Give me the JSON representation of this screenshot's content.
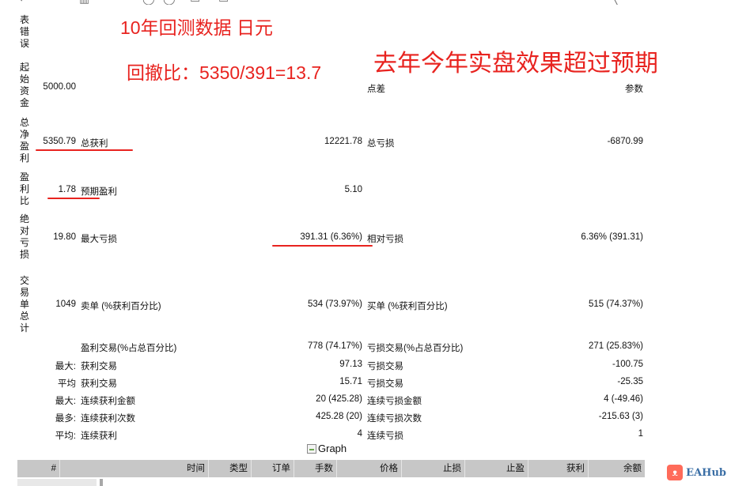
{
  "vertical_labels": {
    "report_error": "表错误",
    "initial_capital": "起始资金",
    "total_net_profit": "总净盈利",
    "profit_ratio": "盈利比",
    "absolute_loss": "绝对亏损",
    "total_trades": "交易单总计"
  },
  "annotations": {
    "title": "10年回测数据 日元",
    "drawdown_ratio": "回撤比：5350/391=13.7",
    "live_note": "去年今年实盘效果超过预期"
  },
  "report": {
    "initial_capital": "5000.00",
    "spread_label": "点差",
    "params_label": "参数",
    "net_profit": "5350.79",
    "gross_profit_label": "总获利",
    "gross_profit": "12221.78",
    "gross_loss_label": "总亏损",
    "gross_loss": "-6870.99",
    "profit_ratio": "1.78",
    "expected_payoff_label": "预期盈利",
    "expected_payoff": "5.10",
    "absolute_drawdown": "19.80",
    "max_drawdown_label": "最大亏损",
    "max_drawdown": "391.31 (6.36%)",
    "relative_drawdown_label": "相对亏损",
    "relative_drawdown": "6.36% (391.31)",
    "total_trades": "1049",
    "short_label": "卖单 (%获利百分比)",
    "short_value": "534 (73.97%)",
    "long_label": "买单 (%获利百分比)",
    "long_value": "515 (74.37%)",
    "profit_trades_label": "盈利交易(%占总百分比)",
    "profit_trades": "778 (74.17%)",
    "loss_trades_label": "亏损交易(%占总百分比)",
    "loss_trades": "271 (25.83%)",
    "largest_prefix": "最大:",
    "largest_profit_label": "获利交易",
    "largest_profit": "97.13",
    "largest_loss_label": "亏损交易",
    "largest_loss": "-100.75",
    "average_prefix": "平均",
    "average_profit_label": "获利交易",
    "average_profit": "15.71",
    "average_loss_label": "亏损交易",
    "average_loss": "-25.35",
    "max_prefix": "最大:",
    "max_consec_wins_label": "连续获利金额",
    "max_consec_wins": "20 (425.28)",
    "max_consec_losses_label": "连续亏损金额",
    "max_consec_losses": "4 (-49.46)",
    "most_prefix": "最多:",
    "max_consec_profit_label": "连续获利次数",
    "max_consec_profit": "425.28 (20)",
    "max_consec_loss_label": "连续亏损次数",
    "max_consec_loss": "-215.63 (3)",
    "avg_prefix": "平均:",
    "avg_consec_wins_label": "连续获利",
    "avg_consec_wins": "4",
    "avg_consec_losses_label": "连续亏损",
    "avg_consec_losses": "1"
  },
  "graph_alt": "Graph",
  "table_headers": [
    "#",
    "时间",
    "类型",
    "订单",
    "手数",
    "价格",
    "止损",
    "止盈",
    "获利",
    "余额"
  ],
  "watermark": "EAHub",
  "colors": {
    "annotation_red": "#e8231f",
    "header_gray": "#c7c7c7"
  }
}
